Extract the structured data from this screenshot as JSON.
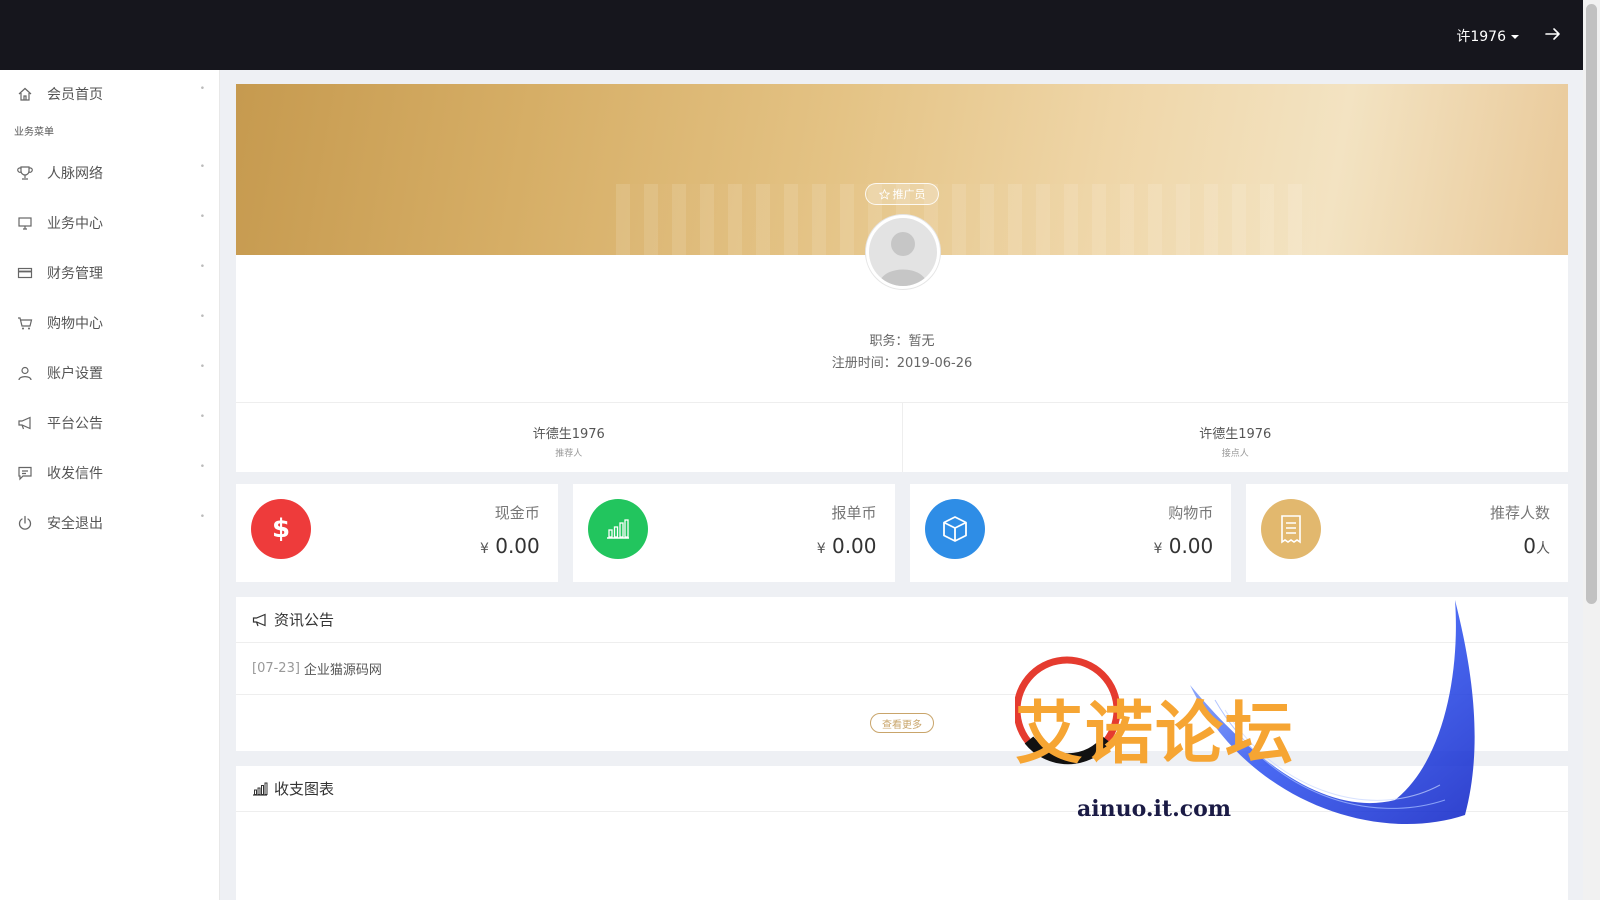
{
  "header": {
    "username": "许1976"
  },
  "sidebar": {
    "home": {
      "label": "会员首页"
    },
    "section_label": "业务菜单",
    "items": [
      {
        "label": "人脉网络",
        "icon": "trophy-icon"
      },
      {
        "label": "业务中心",
        "icon": "monitor-icon"
      },
      {
        "label": "财务管理",
        "icon": "card-icon"
      },
      {
        "label": "购物中心",
        "icon": "cart-icon"
      },
      {
        "label": "账户设置",
        "icon": "user-icon"
      },
      {
        "label": "平台公告",
        "icon": "megaphone-icon"
      },
      {
        "label": "收发信件",
        "icon": "message-icon"
      },
      {
        "label": "安全退出",
        "icon": "power-icon"
      }
    ]
  },
  "profile": {
    "role_badge": "推广员",
    "position_label": "职务：",
    "position_value": "暂无",
    "register_label": "注册时间：",
    "register_value": "2019-06-26",
    "referrer_name": "许德生1976",
    "referrer_label": "推荐人",
    "contact_name": "许德生1976",
    "contact_label": "接点人"
  },
  "stats": [
    {
      "label": "现金币",
      "currency": "¥",
      "value": "0.00",
      "color": "#ee3b3b",
      "icon": "dollar-icon"
    },
    {
      "label": "报单币",
      "currency": "¥",
      "value": "0.00",
      "color": "#22c55e",
      "icon": "bar-chart-icon"
    },
    {
      "label": "购物币",
      "currency": "¥",
      "value": "0.00",
      "color": "#2e8de6",
      "icon": "box-icon"
    },
    {
      "label": "推荐人数",
      "value": "0",
      "unit": "人",
      "color": "#e2b86e",
      "icon": "receipt-icon"
    }
  ],
  "news": {
    "title": "资讯公告",
    "items": [
      {
        "date": "[07-23]",
        "title": "企业猫源码网"
      }
    ],
    "more_label": "查看更多"
  },
  "chart_panel": {
    "title": "收支图表"
  },
  "watermark": {
    "text": "艾诺论坛",
    "url": "ainuo.it.com"
  }
}
